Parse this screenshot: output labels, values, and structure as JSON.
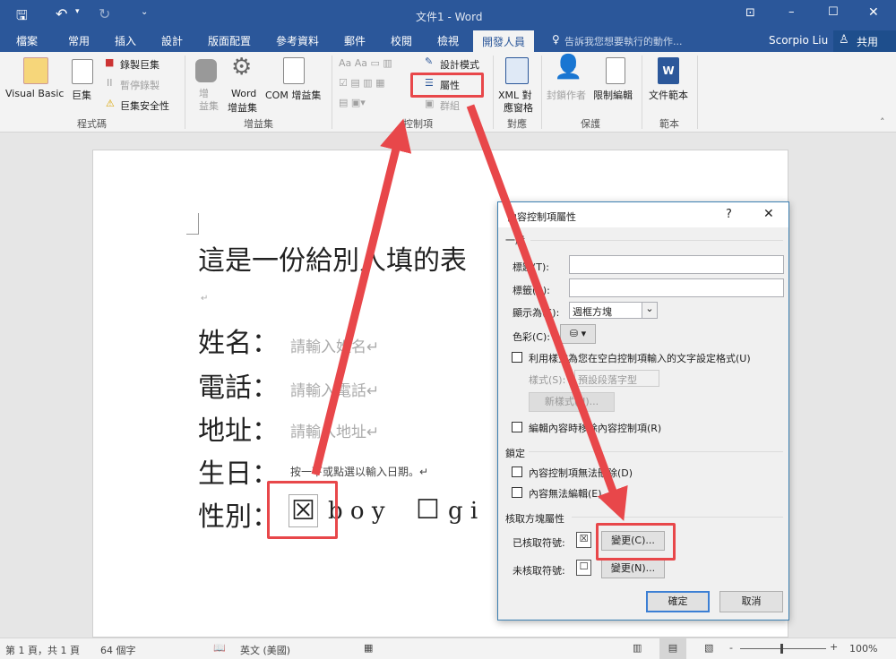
{
  "titlebar": {
    "title": "文件1 - Word",
    "qat_more": "⌄"
  },
  "tabs": [
    "檔案",
    "常用",
    "插入",
    "設計",
    "版面配置",
    "參考資料",
    "郵件",
    "校閱",
    "檢視",
    "開發人員"
  ],
  "tell_me": "告訴我您想要執行的動作...",
  "user": "Scorpio Liu",
  "share": "共用",
  "ribbon": {
    "code": {
      "label": "程式碼",
      "visual_basic": "Visual Basic",
      "macros": "巨集",
      "record": "錄製巨集",
      "pause": "暫停錄製",
      "security": "巨集安全性"
    },
    "addins": {
      "label": "增益集",
      "addins": "增\n益集",
      "word_addins_1": "Word",
      "word_addins_2": "增益集",
      "com_addins": "COM 增益集"
    },
    "controls": {
      "label": "控制項",
      "design_mode": "設計模式",
      "properties": "屬性",
      "group": "群組"
    },
    "mapping": {
      "label": "對應",
      "xml_1": "XML 對",
      "xml_2": "應窗格"
    },
    "protect": {
      "label": "保護",
      "block_authors": "封鎖作者",
      "restrict": "限制編輯"
    },
    "templates": {
      "label": "範本",
      "doc_template": "文件範本"
    }
  },
  "document": {
    "heading": "這是一份給別人填的表",
    "para_mark": "↵",
    "fields": [
      {
        "label": "姓名：",
        "placeholder": "請輸入姓名↵"
      },
      {
        "label": "電話：",
        "placeholder": "請輸入電話↵"
      },
      {
        "label": "地址：",
        "placeholder": "請輸入地址↵"
      }
    ],
    "birthday_label": "生日：",
    "birthday_placeholder": "按一下或點選以輸入日期。↵",
    "gender_label": "性別：",
    "checked_symbol": "☒",
    "boy": "b o y",
    "unchecked_symbol": "☐",
    "girl": "g i"
  },
  "dialog": {
    "title": "內容控制項屬性",
    "help": "?",
    "close": "✕",
    "general": "一般",
    "title_label": "標題(T):",
    "title_value": "",
    "tag_label": "標籤(A):",
    "tag_value": "",
    "show_as_label": "顯示為(S):",
    "show_as_value": "週框方塊",
    "color_label": "色彩(C):",
    "use_style": "利用樣式為您在空白控制項輸入的文字設定格式(U)",
    "style_label": "樣式(S):",
    "style_value": "預設段落字型",
    "new_style": "新樣式(N)...",
    "remove_on_edit": "編輯內容時移除內容控制項(R)",
    "locking": "鎖定",
    "cannot_delete": "內容控制項無法刪除(D)",
    "cannot_edit": "內容無法編輯(E)",
    "checkbox_props": "核取方塊屬性",
    "checked_label": "已核取符號:",
    "checked_symbol": "☒",
    "change_checked": "變更(C)...",
    "unchecked_label": "未核取符號:",
    "unchecked_symbol": "☐",
    "change_unchecked": "變更(N)...",
    "ok": "確定",
    "cancel": "取消"
  },
  "status": {
    "page": "第 1 頁，共 1 頁",
    "words": "64 個字",
    "language": "英文 (美國)",
    "zoom": "100%"
  },
  "colors": {
    "brand": "#2b579a",
    "annotation": "#e8474a"
  }
}
